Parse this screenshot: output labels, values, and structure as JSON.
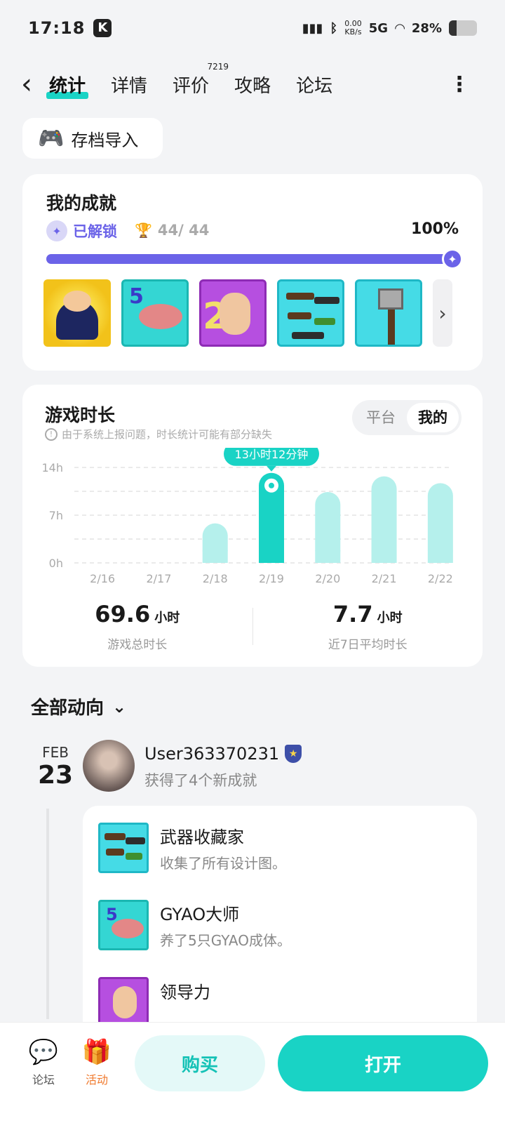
{
  "status": {
    "time": "17:18",
    "k_label": "K",
    "speed_value": "0.00",
    "speed_unit": "KB/s",
    "network": "5G",
    "battery": "28%",
    "battery_level": 0.28
  },
  "nav": {
    "back": "‹",
    "tabs": [
      {
        "label": "统计"
      },
      {
        "label": "详情"
      },
      {
        "label": "评价",
        "count": "7219"
      },
      {
        "label": "攻略"
      },
      {
        "label": "论坛"
      }
    ],
    "more": "⋮"
  },
  "import_button": {
    "label": "存档导入",
    "icon": "gamepad-icon"
  },
  "achievements": {
    "title": "我的成就",
    "unlocked_label": "已解锁",
    "count": "44/ 44",
    "percent": "100%",
    "progress": 1.0,
    "icons": [
      "miner-achievement-icon",
      "fish-5-achievement-icon",
      "portrait-20-achievement-icon",
      "weapons-achievement-icon",
      "hammer-achievement-icon"
    ]
  },
  "playtime": {
    "title": "游戏时长",
    "note": "由于系统上报问题，时长统计可能有部分缺失",
    "toggle": [
      "平台",
      "我的"
    ],
    "toggle_selected": "我的",
    "total_value": "69.6",
    "total_unit": "小时",
    "total_label": "游戏总时长",
    "avg_value": "7.7",
    "avg_unit": "小时",
    "avg_label": "近7日平均时长"
  },
  "chart_data": {
    "type": "bar",
    "categories": [
      "2/16",
      "2/17",
      "2/18",
      "2/19",
      "2/20",
      "2/21",
      "2/22"
    ],
    "values": [
      0,
      0,
      5.8,
      13.2,
      10.4,
      12.7,
      11.7
    ],
    "highlight_index": 3,
    "highlight_label": "13小时12分钟",
    "y_ticks": [
      "14h",
      "7h",
      "0h"
    ],
    "ylim": [
      0,
      14
    ],
    "grid": true,
    "colors": {
      "bar": "#b5f0ec",
      "highlight": "#19d3c5"
    }
  },
  "feed": {
    "section_title": "全部动向",
    "month": "FEB",
    "day": "23",
    "username": "User363370231",
    "subtitle": "获得了4个新成就",
    "items": [
      {
        "title": "武器收藏家",
        "desc": "收集了所有设计图。"
      },
      {
        "title": "GYAO大师",
        "desc": "养了5只GYAO成体。"
      },
      {
        "title": "领导力",
        "desc": ""
      }
    ]
  },
  "bottom": {
    "forum_label": "论坛",
    "activity_label": "活动",
    "buy_label": "购买",
    "open_label": "打开"
  },
  "colors": {
    "accent": "#19d3c5",
    "purple": "#6b63e8",
    "orange": "#f07a2e"
  }
}
